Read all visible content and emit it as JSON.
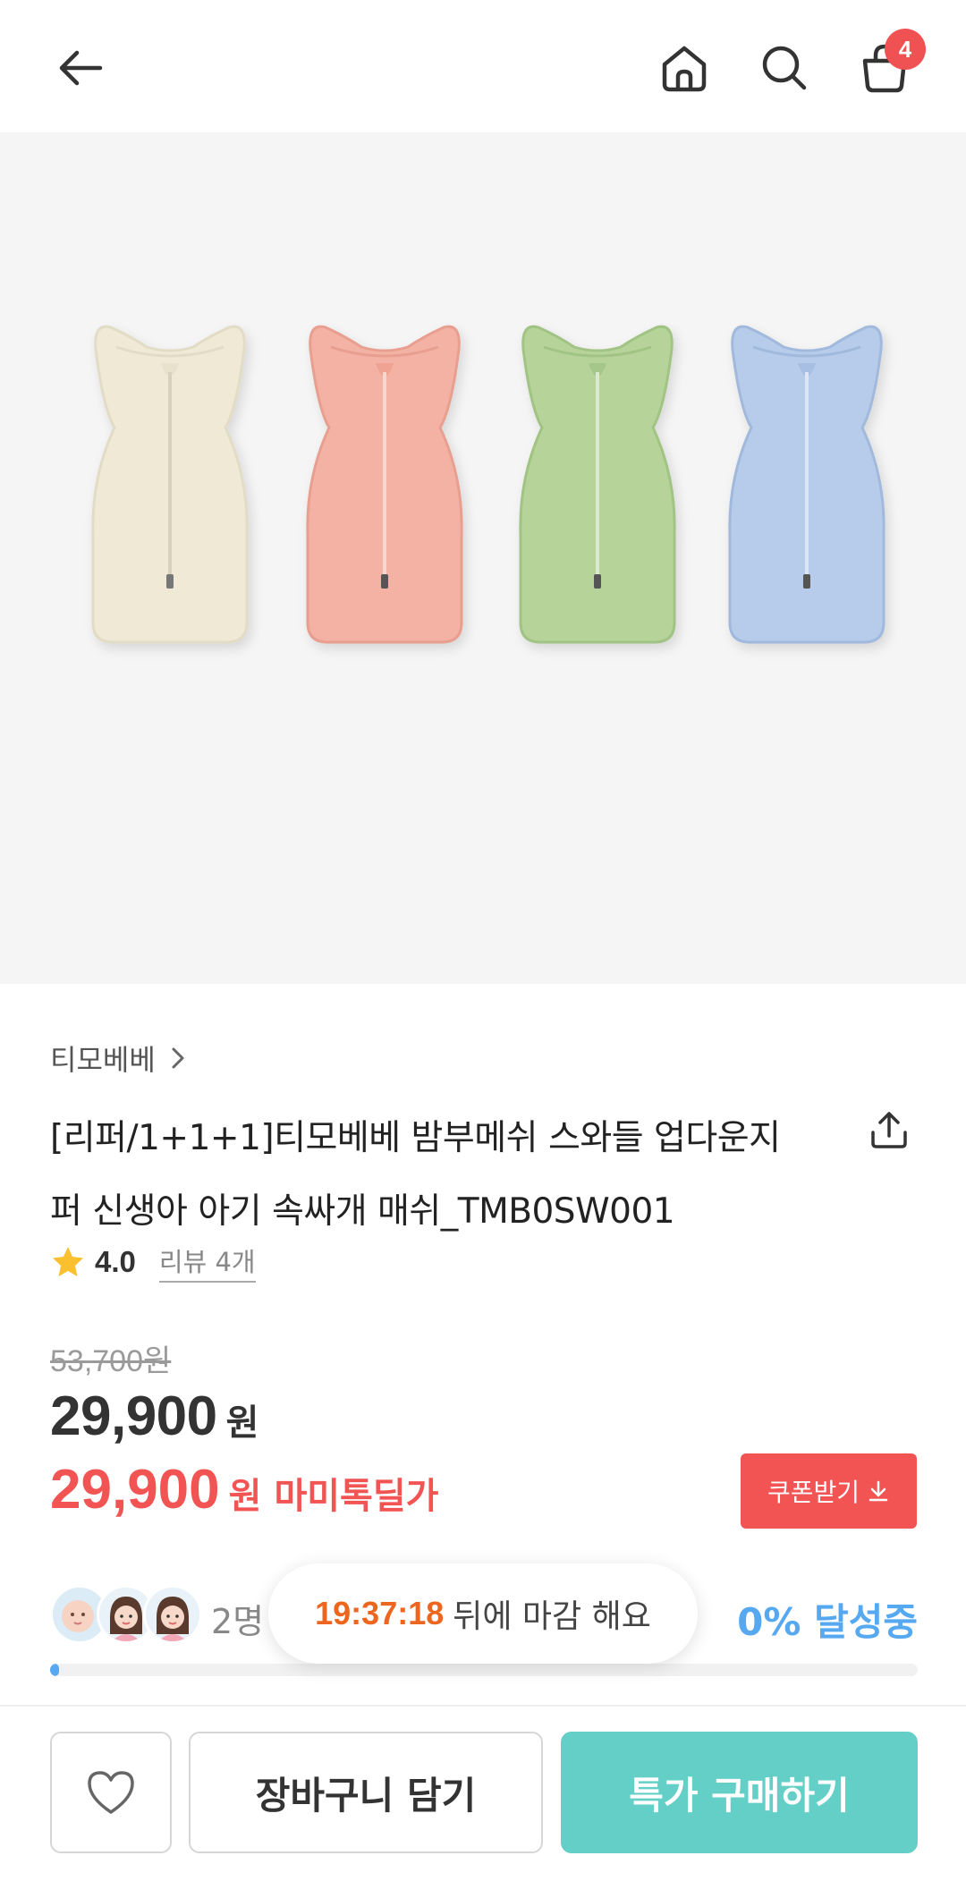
{
  "header": {
    "back_icon": "arrow-left-icon",
    "home_icon": "home-icon",
    "search_icon": "search-icon",
    "cart_icon": "shopping-bag-icon",
    "cart_count": "4"
  },
  "product_image": {
    "items": [
      {
        "color_name": "cream",
        "color": "#efe9d6"
      },
      {
        "color_name": "pink",
        "color": "#f3b2a4"
      },
      {
        "color_name": "green",
        "color": "#b6d49a"
      },
      {
        "color_name": "blue",
        "color": "#b6ccea"
      }
    ]
  },
  "product": {
    "brand": "티모베베",
    "title": "[리퍼/1+1+1]티모베베 밤부메쉬 스와들 업다운지퍼 신생아 아기 속싸개 매쉬_TMB0SW001",
    "title_line1": "[리퍼/1+1+1]티모베베 밤부메쉬 스와들 업다운지",
    "title_line2": "퍼 신생아 아기 속싸개 매쉬_TMB0SW001",
    "rating": "4.0",
    "review_label": "리뷰 4개",
    "original_price": "53,700원",
    "price": "29,900",
    "price_unit": "원",
    "deal_price": "29,900",
    "deal_unit": "원",
    "deal_label": "마미톡딜가",
    "coupon_label": "쿠폰받기"
  },
  "group_buy": {
    "participants_label": "2명",
    "timer": "19:37:18",
    "timer_suffix": "뒤에 마감 해요",
    "progress_label": "0% 달성중",
    "progress_fraction": 0.01
  },
  "bottom_bar": {
    "wish_icon": "heart-icon",
    "cart_button": "장바구니 담기",
    "buy_button": "특가 구매하기"
  },
  "colors": {
    "accent_red": "#f25454",
    "accent_teal": "#63cfc6",
    "accent_blue": "#56a8f0",
    "timer_orange": "#ec6620"
  }
}
